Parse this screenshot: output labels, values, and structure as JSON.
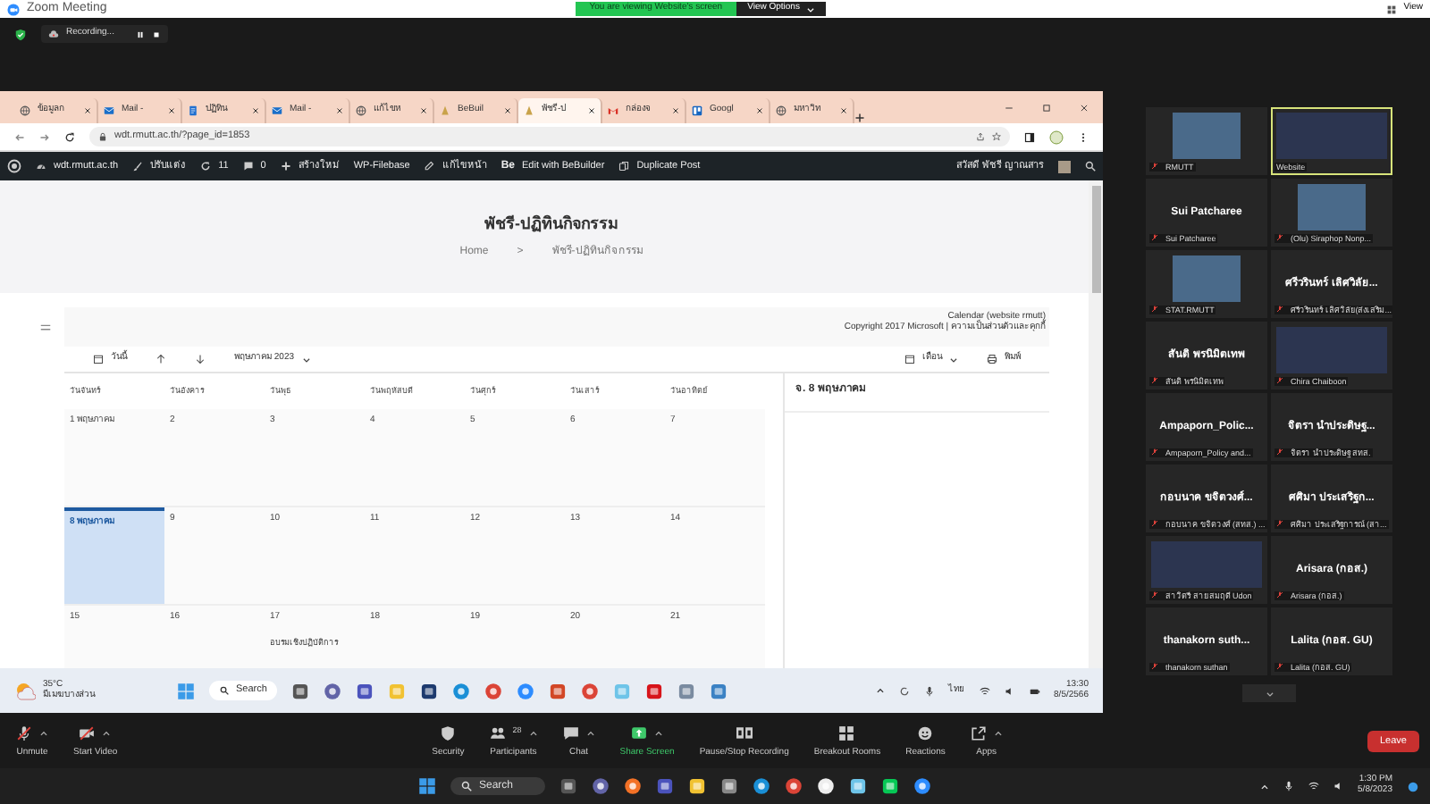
{
  "window": {
    "title": "Zoom Meeting",
    "viewing_banner": "You are viewing Website's screen",
    "view_options": "View Options",
    "view_button": "View"
  },
  "recording": {
    "label": "Recording..."
  },
  "browser": {
    "tabs": [
      {
        "label": "ข้อมูลก",
        "kind": "globe",
        "selected": false
      },
      {
        "label": "Mail -",
        "kind": "mail",
        "selected": false
      },
      {
        "label": "ปฏิทิน",
        "kind": "doc",
        "selected": false
      },
      {
        "label": "Mail -",
        "kind": "mail",
        "selected": false
      },
      {
        "label": "แก้ไขห",
        "kind": "globe",
        "selected": false
      },
      {
        "label": "BeBuil",
        "kind": "cone",
        "selected": false
      },
      {
        "label": "พัชรี-ป",
        "kind": "cone",
        "selected": true
      },
      {
        "label": "กล่องจ",
        "kind": "envelope",
        "selected": false
      },
      {
        "label": "Googl",
        "kind": "board",
        "selected": false
      },
      {
        "label": "มหาวิท",
        "kind": "globe",
        "selected": false
      }
    ],
    "url": "wdt.rmutt.ac.th/?page_id=1853"
  },
  "wp_admin_bar": {
    "items": [
      {
        "label": "wdt.rmutt.ac.th",
        "kind": "gauge"
      },
      {
        "label": "ปรับแต่ง",
        "kind": "brush"
      },
      {
        "label": "11",
        "kind": "refresh"
      },
      {
        "label": "0",
        "kind": "comment"
      },
      {
        "label": "สร้างใหม่",
        "kind": "plus"
      },
      {
        "label": "WP-Filebase",
        "kind": "plain"
      },
      {
        "label": "แก้ไขหน้า",
        "kind": "pencil"
      },
      {
        "label": "Edit with BeBuilder",
        "kind": "logo",
        "logo_text": "Be"
      },
      {
        "label": "Duplicate Post",
        "kind": "copy"
      }
    ],
    "greeting": "สวัสดี พัชรี ญาณสาร"
  },
  "page": {
    "title": "พัชรี-ปฏิทินกิจกรรม",
    "breadcrumb": [
      "Home",
      "พัชรี-ปฏิทินกิจกรรม"
    ],
    "breadcrumb_separator": ">"
  },
  "calendar": {
    "name": "Calendar (website rmutt)",
    "copyright": "Copyright 2017 Microsoft |",
    "privacy_link": "ความเป็นส่วนตัวและคุกกี้",
    "today_button": "วันนี้",
    "month": "พฤษภาคม 2023",
    "view_button": "เดือน",
    "print_button": "พิมพ์",
    "weekdays": [
      "วันจันทร์",
      "วันอังคาร",
      "วันพุธ",
      "วันพฤหัสบดี",
      "วันศุกร์",
      "วันเสาร์",
      "วันอาทิตย์"
    ],
    "weeks": [
      [
        {
          "label": "1 พฤษภาคม",
          "selected": false
        },
        {
          "label": "2",
          "selected": false
        },
        {
          "label": "3",
          "selected": false
        },
        {
          "label": "4",
          "selected": false
        },
        {
          "label": "5",
          "selected": false
        },
        {
          "label": "6",
          "selected": false
        },
        {
          "label": "7",
          "selected": false
        }
      ],
      [
        {
          "label": "8 พฤษภาคม",
          "selected": true
        },
        {
          "label": "9",
          "selected": false
        },
        {
          "label": "10",
          "selected": false
        },
        {
          "label": "11",
          "selected": false
        },
        {
          "label": "12",
          "selected": false
        },
        {
          "label": "13",
          "selected": false
        },
        {
          "label": "14",
          "selected": false
        }
      ],
      [
        {
          "label": "15",
          "selected": false
        },
        {
          "label": "16",
          "selected": false
        },
        {
          "label": "17",
          "selected": false,
          "event": "อบรมเชิงปฏิบัติการ"
        },
        {
          "label": "18",
          "selected": false
        },
        {
          "label": "19",
          "selected": false
        },
        {
          "label": "20",
          "selected": false
        },
        {
          "label": "21",
          "selected": false
        }
      ]
    ],
    "side_panel_title": "จ. 8 พฤษภาคม"
  },
  "shared_taskbar": {
    "weather_temp": "35°C",
    "weather_text": "มีเมฆบางส่วน",
    "search": "Search",
    "apps": [
      {
        "kind": "taskview"
      },
      {
        "kind": "chat"
      },
      {
        "kind": "teams"
      },
      {
        "kind": "folder"
      },
      {
        "kind": "store"
      },
      {
        "kind": "edge"
      },
      {
        "kind": "chrome"
      },
      {
        "kind": "zoom"
      },
      {
        "kind": "office"
      },
      {
        "kind": "chrome"
      },
      {
        "kind": "notepad"
      },
      {
        "kind": "acrobat"
      },
      {
        "kind": "settings"
      },
      {
        "kind": "photos"
      }
    ],
    "language": "ไทย",
    "time": "13:30",
    "date": "8/5/2566"
  },
  "gallery": {
    "tiles": [
      {
        "kind": "image",
        "label": "RMUTT",
        "muted": true,
        "active_speaker": false
      },
      {
        "kind": "video",
        "label": "Website",
        "muted": false,
        "active_speaker": true
      },
      {
        "kind": "name",
        "display_name": "Sui Patcharee",
        "label": "Sui Patcharee",
        "muted": true,
        "active_speaker": false
      },
      {
        "kind": "image",
        "label": "(Olu) Siraphop Nonp...",
        "muted": true,
        "active_speaker": false
      },
      {
        "kind": "image",
        "label": "STAT.RMUTT",
        "muted": true,
        "active_speaker": false
      },
      {
        "kind": "name",
        "display_name": "ศรีวรินทร์ เลิศวิลัย...",
        "label": "ศรีวรินทร์ เลิศวิลัย(ส่งเสริม...",
        "muted": true,
        "active_speaker": false
      },
      {
        "kind": "name",
        "display_name": "สันติ พรนิมิตเทพ",
        "label": "สันติ พรนิมิตเทพ",
        "muted": true,
        "active_speaker": false
      },
      {
        "kind": "video",
        "label": "Chira Chaiboon",
        "muted": true,
        "active_speaker": false
      },
      {
        "kind": "name",
        "display_name": "Ampaporn_Polic...",
        "label": "Ampaporn_Policy and...",
        "muted": true,
        "active_speaker": false
      },
      {
        "kind": "name",
        "display_name": "จิตรา นำประดิษฐ...",
        "label": "จิตรา นำประดิษฐ สทส.",
        "muted": true,
        "active_speaker": false
      },
      {
        "kind": "name",
        "display_name": "กอบนาค ขจิตวงศ์...",
        "label": "กอบนาค ขจิตวงศ์ (สทส.) ...",
        "muted": true,
        "active_speaker": false
      },
      {
        "kind": "name",
        "display_name": "ศศิมา ประเสริฐก...",
        "label": "ศศิมา ประเสริฐการณ์ (สา...",
        "muted": true,
        "active_speaker": false
      },
      {
        "kind": "video",
        "label": "สาวิตรี สายสมฤดี Udon",
        "muted": true,
        "active_speaker": false
      },
      {
        "kind": "name",
        "display_name": "Arisara (กอส.)",
        "label": "Arisara (กอส.)",
        "muted": true,
        "active_speaker": false
      },
      {
        "kind": "name",
        "display_name": "thanakorn  suth...",
        "label": "thanakorn  suthan",
        "muted": true,
        "active_speaker": false
      },
      {
        "kind": "name",
        "display_name": "Lalita (กอส. GU)",
        "label": "Lalita (กอส. GU)",
        "muted": true,
        "active_speaker": false
      }
    ]
  },
  "toolbar": {
    "buttons": [
      {
        "label": "Unmute",
        "kind": "mic_off",
        "has_menu": true
      },
      {
        "label": "Start Video",
        "kind": "video_off",
        "has_menu": true
      },
      {
        "label": "Security",
        "kind": "shield",
        "has_menu": false
      },
      {
        "label": "Participants",
        "kind": "people",
        "count": "28",
        "has_menu": true
      },
      {
        "label": "Chat",
        "kind": "chat",
        "has_menu": true
      },
      {
        "label": "Share Screen",
        "kind": "share",
        "has_menu": true
      },
      {
        "label": "Pause/Stop Recording",
        "kind": "record",
        "has_menu": false
      },
      {
        "label": "Breakout Rooms",
        "kind": "rooms",
        "has_menu": false
      },
      {
        "label": "Reactions",
        "kind": "reactions",
        "has_menu": false
      },
      {
        "label": "Apps",
        "kind": "apps",
        "has_menu": true
      }
    ],
    "leave": "Leave"
  },
  "taskbar": {
    "search": "Search",
    "apps": [
      {
        "kind": "taskview"
      },
      {
        "kind": "chat"
      },
      {
        "kind": "firefox"
      },
      {
        "kind": "teams"
      },
      {
        "kind": "folder"
      },
      {
        "kind": "pen"
      },
      {
        "kind": "edge"
      },
      {
        "kind": "chrome"
      },
      {
        "kind": "ring"
      },
      {
        "kind": "notepad"
      },
      {
        "kind": "line"
      },
      {
        "kind": "zoom"
      }
    ],
    "time": "1:30 PM",
    "date": "5/8/2023"
  }
}
